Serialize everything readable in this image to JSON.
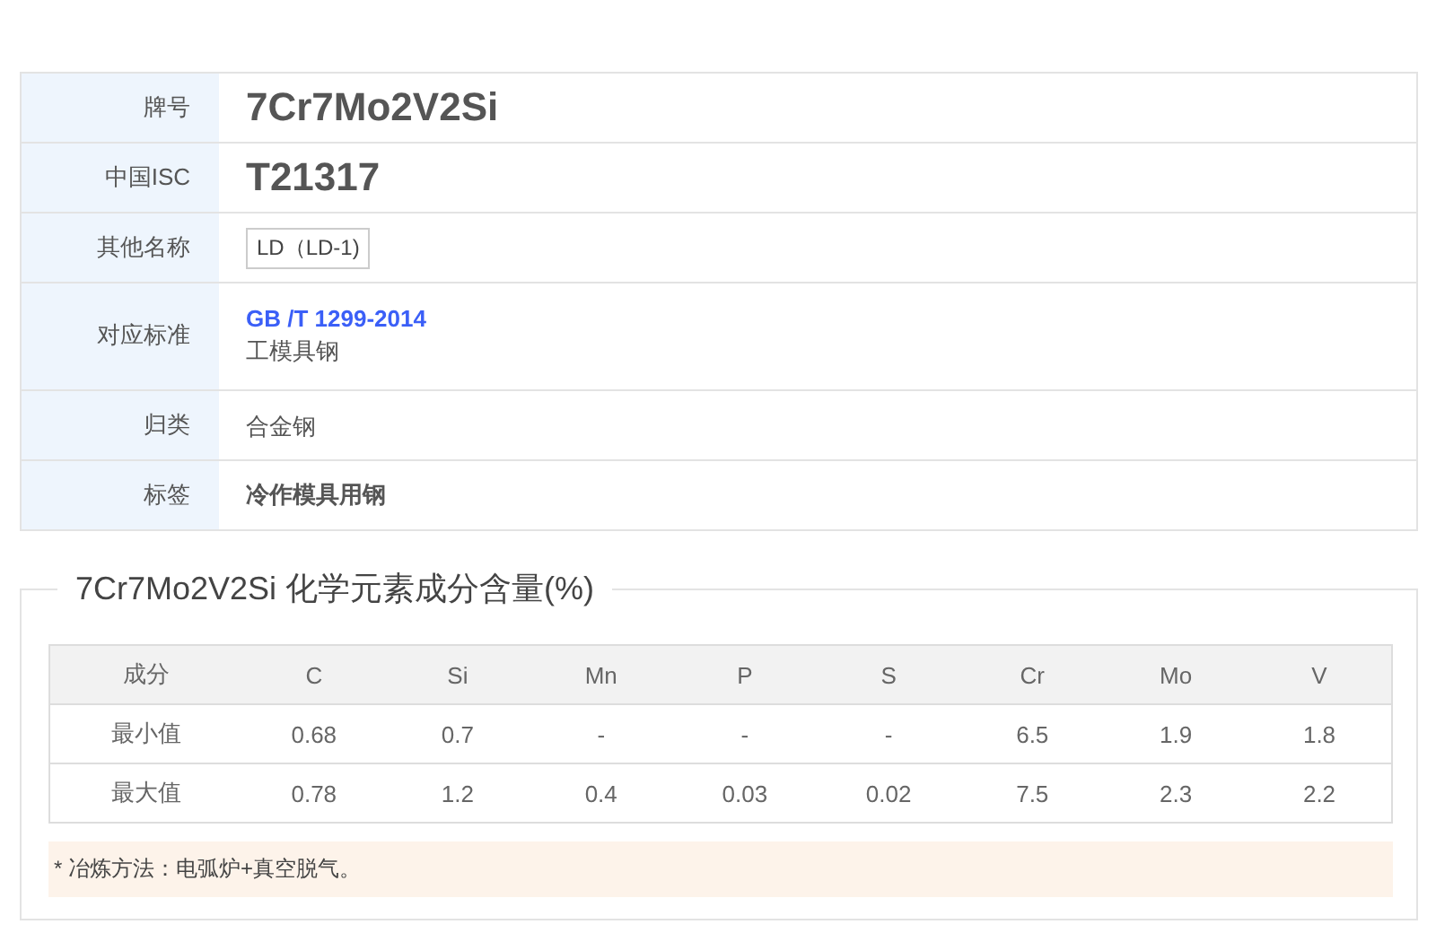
{
  "info_rows": [
    {
      "label": "牌号",
      "kind": "title",
      "value": "7Cr7Mo2V2Si"
    },
    {
      "label": "中国ISC",
      "kind": "title",
      "value": "T21317"
    },
    {
      "label": "其他名称",
      "kind": "tag",
      "value": "LD（LD-1)"
    },
    {
      "label": "对应标准",
      "kind": "standard",
      "link": "GB /T 1299-2014",
      "value": "工模具钢"
    },
    {
      "label": "归类",
      "kind": "plain",
      "value": "合金钢"
    },
    {
      "label": "标签",
      "kind": "bold",
      "value": "冷作模具用钢"
    }
  ],
  "composition": {
    "title": "7Cr7Mo2V2Si 化学元素成分含量(%)",
    "columns": [
      "成分",
      "C",
      "Si",
      "Mn",
      "P",
      "S",
      "Cr",
      "Mo",
      "V"
    ],
    "rows": [
      [
        "最小值",
        "0.68",
        "0.7",
        "-",
        "-",
        "-",
        "6.5",
        "1.9",
        "1.8"
      ],
      [
        "最大值",
        "0.78",
        "1.2",
        "0.4",
        "0.03",
        "0.02",
        "7.5",
        "2.3",
        "2.2"
      ]
    ],
    "note": "* 冶炼方法：电弧炉+真空脱气。"
  }
}
